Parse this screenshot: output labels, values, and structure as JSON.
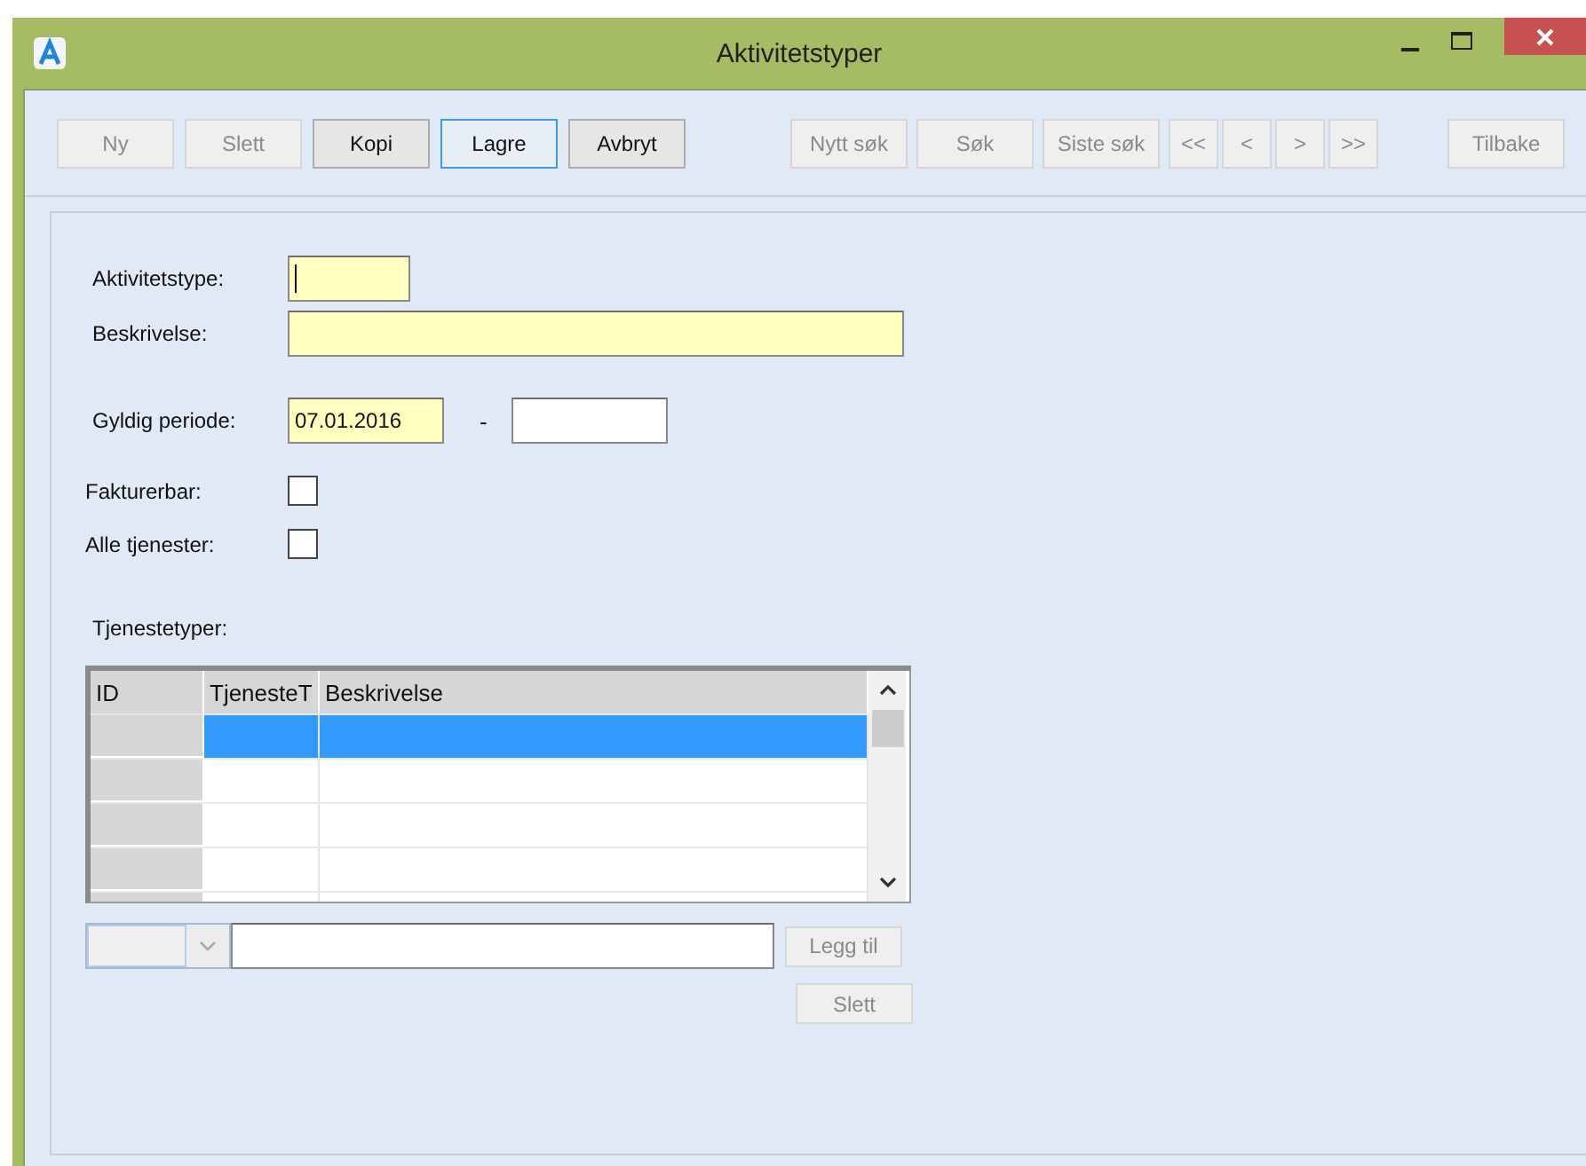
{
  "window": {
    "title": "Aktivitetstyper"
  },
  "toolbar": {
    "groups": [
      [
        {
          "label": "Ny",
          "disabled": true,
          "focused": false
        },
        {
          "label": "Slett",
          "disabled": true,
          "focused": false
        },
        {
          "label": "Kopi",
          "disabled": false,
          "focused": false
        },
        {
          "label": "Lagre",
          "disabled": false,
          "focused": true
        },
        {
          "label": "Avbryt",
          "disabled": false,
          "focused": false
        }
      ],
      [
        {
          "label": "Nytt søk",
          "disabled": true,
          "focused": false
        },
        {
          "label": "Søk",
          "disabled": true,
          "focused": false
        },
        {
          "label": "Siste søk",
          "disabled": true,
          "focused": false
        },
        {
          "label": "<<",
          "kind": "nav",
          "disabled": true,
          "focused": false
        },
        {
          "label": "<",
          "kind": "nav",
          "disabled": true,
          "focused": false
        },
        {
          "label": ">",
          "kind": "nav",
          "disabled": true,
          "focused": false
        },
        {
          "label": ">>",
          "kind": "nav",
          "disabled": true,
          "focused": false
        }
      ],
      [
        {
          "label": "Tilbake",
          "disabled": true,
          "focused": false
        }
      ]
    ]
  },
  "form": {
    "aktivitetstype": {
      "label": "Aktivitetstype:",
      "required": true,
      "focused": true
    },
    "beskrivelse": {
      "label": "Beskrivelse:",
      "required": true
    },
    "periode": {
      "label": "Gyldig periode:",
      "from": {
        "value": "07.01.2016",
        "required": true
      },
      "separator": "-",
      "to": {
        "required": false
      }
    },
    "checkboxes": [
      {
        "label": "Fakturerbar:",
        "checked": false
      },
      {
        "label": "Alle tjenester:",
        "checked": false
      }
    ],
    "tjenestetyper": {
      "label": "Tjenestetyper:",
      "columns": [
        "ID",
        "TjenesteT",
        "Beskrivelse"
      ],
      "rows": [
        {
          "selected": true
        },
        {
          "selected": false
        },
        {
          "selected": false
        },
        {
          "selected": false
        },
        {
          "selected": false
        }
      ]
    },
    "add_button": {
      "label": "Legg til",
      "disabled": true
    },
    "delete_button": {
      "label": "Slett",
      "disabled": true
    }
  }
}
